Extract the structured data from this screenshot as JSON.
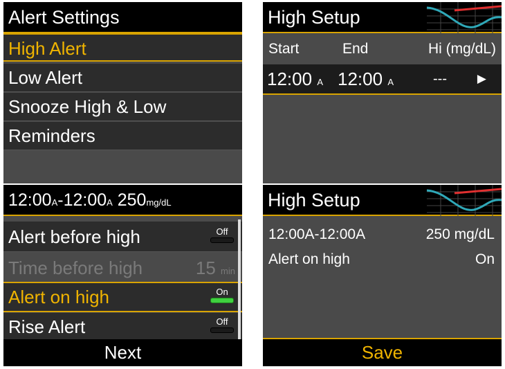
{
  "alert_settings": {
    "title": "Alert Settings",
    "items": [
      {
        "label": "High Alert"
      },
      {
        "label": "Low Alert"
      },
      {
        "label": "Snooze High & Low"
      },
      {
        "label": "Reminders"
      }
    ]
  },
  "high_setup_list": {
    "title": "High Setup",
    "columns": {
      "start": "Start",
      "end": "End",
      "hi": "Hi (mg/dL)"
    },
    "row": {
      "start_time": "12:00",
      "start_ampm": "A",
      "end_time": "12:00",
      "end_ampm": "A",
      "hi_value": "---"
    }
  },
  "segment_edit": {
    "title_start": "12:00",
    "title_start_ampm": "A",
    "title_sep": "-",
    "title_end": "12:00",
    "title_end_ampm": "A",
    "title_value": "250",
    "title_unit": "mg/dL",
    "options": [
      {
        "label": "Alert before high",
        "toggle": "Off"
      },
      {
        "label": "Time before high",
        "value": "15",
        "unit": "min"
      },
      {
        "label": "Alert on high",
        "toggle": "On"
      },
      {
        "label": "Rise Alert",
        "toggle": "Off"
      }
    ],
    "next_label": "Next"
  },
  "high_setup_summary": {
    "title": "High Setup",
    "segment": "12:00A-12:00A",
    "segment_value": "250 mg/dL",
    "alert_label": "Alert on high",
    "alert_value": "On",
    "save_label": "Save"
  },
  "colors": {
    "highlight": "#f0b400",
    "toggle_on": "#3fd13f",
    "graph_high_line": "#e03030",
    "graph_curve": "#2fa8b8"
  }
}
